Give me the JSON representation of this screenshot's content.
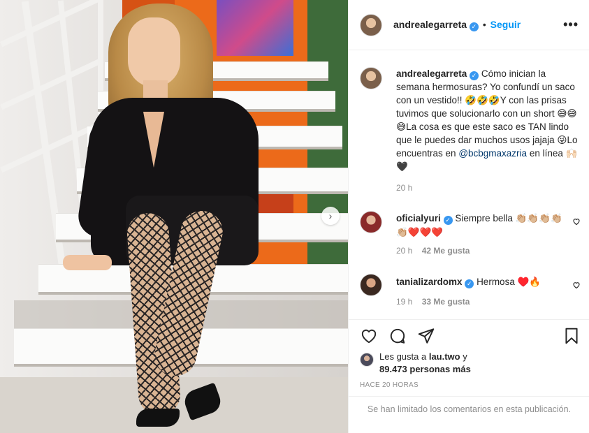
{
  "post": {
    "image_alt": "photo",
    "next_glyph": "›"
  },
  "header": {
    "username": "andrealegarreta",
    "verified_glyph": "✓",
    "separator": "•",
    "follow_label": "Seguir",
    "more_glyph": "•••"
  },
  "caption": {
    "username": "andrealegarreta",
    "text_1": "Cómo inician la semana hermosuras? Yo confundí un saco con un vestido!! ",
    "emoji_1": "🤣🤣🤣",
    "text_2": "Y con las prisas tuvimos que solucionarlo con un short ",
    "emoji_2": "😅😅😅",
    "text_3": "La cosa es que este saco es TAN lindo que le puedes dar muchos usos jajaja ",
    "emoji_3": "😜",
    "text_4": "Lo encuentras en ",
    "mention": "@bcbgmaxazria",
    "text_5": " en línea ",
    "emoji_4": "🙌🏻🖤",
    "time": "20 h"
  },
  "comments": [
    {
      "username": "oficialyuri",
      "text": "Siempre bella ",
      "emoji": "👏🏼👏🏼👏🏼👏🏼👏🏼❤️❤️❤️",
      "time": "20 h",
      "likes": "42 Me gusta"
    },
    {
      "username": "tanializardomx",
      "text": "Hermosa ",
      "emoji": "♥️🔥",
      "time": "19 h",
      "likes": "33 Me gusta"
    }
  ],
  "likes": {
    "prefix": "Les gusta a ",
    "user": "lau.two",
    "suffix": " y",
    "count": "89.473 personas más"
  },
  "posted_ago": "HACE 20 HORAS",
  "footer_text": "Se han limitado los comentarios en esta publicación.",
  "colors": {
    "link": "#0095f6",
    "verified": "#3897f0",
    "muted": "#8e8e8e"
  }
}
